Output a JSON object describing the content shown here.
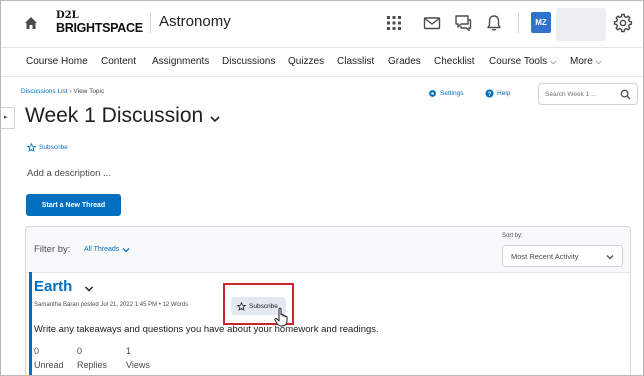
{
  "header": {
    "logo_line1": "D2L",
    "logo_line2": "BRIGHTSPACE",
    "course_title": "Astronomy",
    "user_initials": "MZ"
  },
  "nav": {
    "items": [
      "Course Home",
      "Content",
      "Assignments",
      "Discussions",
      "Quizzes",
      "Classlist",
      "Grades",
      "Checklist"
    ],
    "course_tools": "Course Tools",
    "more": "More"
  },
  "breadcrumb": {
    "parent": "Discussions List",
    "separator": "›",
    "current": "View Topic"
  },
  "page": {
    "title": "Week 1 Discussion",
    "settings_label": "Settings",
    "help_label": "Help",
    "search_placeholder": "Search Week 1 ...",
    "subscribe_label": "Subscribe",
    "add_description": "Add a description ...",
    "start_thread_label": "Start a New Thread"
  },
  "threads": {
    "filter_label": "Filter by:",
    "filter_value": "All Threads",
    "sort_label": "Sort by:",
    "sort_value": "Most Recent Activity",
    "items": [
      {
        "title": "Earth",
        "meta": "Samantha Baran posted Jul 21, 2022 1:45 PM • 12 Words",
        "subscribe_label": "Subscribe",
        "body": "Write any takeaways and questions you have about your homework and readings.",
        "stats": [
          {
            "value": "0",
            "label": "Unread"
          },
          {
            "value": "0",
            "label": "Replies"
          },
          {
            "value": "1",
            "label": "Views"
          }
        ]
      }
    ]
  },
  "colors": {
    "brand_blue": "#006fbf",
    "avatar_blue": "#2f73cf",
    "highlight_red": "#c8262e"
  }
}
